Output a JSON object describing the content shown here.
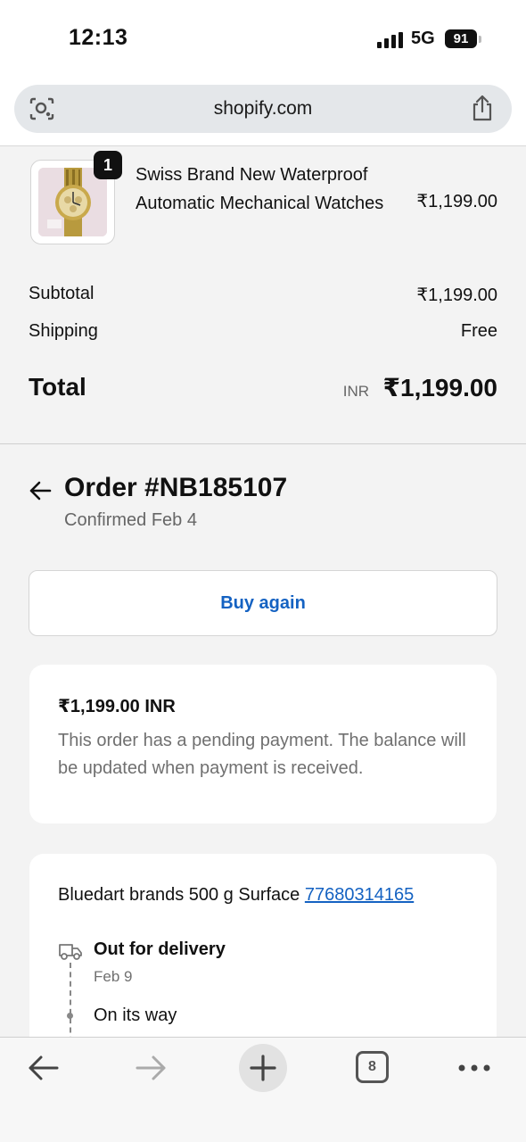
{
  "status_bar": {
    "time": "12:13",
    "network": "5G",
    "battery": "91"
  },
  "browser": {
    "url": "shopify.com",
    "tab_count": "8"
  },
  "summary": {
    "item": {
      "quantity": "1",
      "name": "Swiss Brand New Waterproof Automatic Mechanical Watches",
      "price": "₹1,199.00"
    },
    "subtotal_label": "Subtotal",
    "subtotal_value": "₹1,199.00",
    "shipping_label": "Shipping",
    "shipping_value": "Free",
    "total_label": "Total",
    "total_currency": "INR",
    "total_value": "₹1,199.00"
  },
  "order": {
    "title": "Order #NB185107",
    "status": "Confirmed Feb 4",
    "buy_again_label": "Buy again"
  },
  "payment": {
    "amount": "₹1,199.00 INR",
    "note": "This order has a pending payment. The balance will be updated when payment is received."
  },
  "shipment": {
    "carrier_text": "Bluedart brands 500 g Surface",
    "tracking_number": "77680314165",
    "events": [
      {
        "title": "Out for delivery",
        "date": "Feb 9"
      },
      {
        "title": "On its way"
      }
    ]
  },
  "icons": {
    "lens": "lens-icon",
    "share": "share-icon",
    "back": "arrow-left-icon",
    "truck": "truck-icon"
  },
  "colors": {
    "link": "#1462c2",
    "muted": "#707070"
  }
}
